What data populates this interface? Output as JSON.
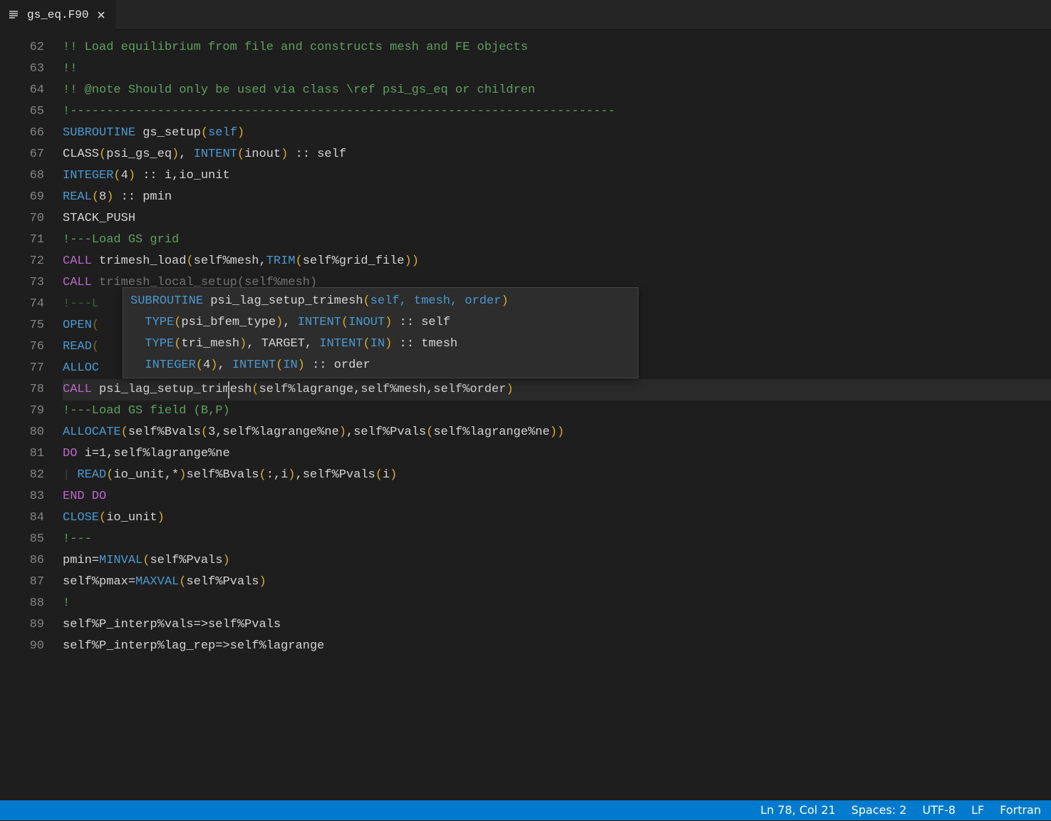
{
  "tab": {
    "filename": "gs_eq.F90"
  },
  "gutter": {
    "start": 62,
    "end": 90
  },
  "colors": {
    "background": "#1e1e1e",
    "statusbar": "#007acc",
    "keyword": "#4a9ad0",
    "control": "#ba68c8",
    "comment": "#5fa05f",
    "bracket": "#d4b02a"
  },
  "code": {
    "l62": "!! Load equilibrium from file and constructs mesh and FE objects",
    "l63": "!!",
    "l64": "!! @note Should only be used via class \\ref psi_gs_eq or children",
    "l65": "!---------------------------------------------------------------------------",
    "l66": {
      "kw": "SUBROUTINE",
      "name": " gs_setup",
      "open": "(",
      "arg": "self",
      "close": ")"
    },
    "l67": {
      "pre": "CLASS",
      "p1": "(",
      "a": "psi_gs_eq",
      "p2": ")",
      "comma": ", ",
      "kw": "INTENT",
      "p3": "(",
      "b": "inout",
      "p4": ")",
      "rest": " :: self"
    },
    "l68": {
      "kw": "INTEGER",
      "p1": "(",
      "n": "4",
      "p2": ")",
      "rest": " :: i,io_unit"
    },
    "l69": {
      "kw": "REAL",
      "p1": "(",
      "n": "8",
      "p2": ")",
      "rest": " :: pmin"
    },
    "l70": "STACK_PUSH",
    "l71": "!---Load GS grid",
    "l72": {
      "call": "CALL",
      "sp": " trimesh_load",
      "p1": "(",
      "a": "self%mesh,",
      "fn": "TRIM",
      "p2": "(",
      "b": "self%grid_file",
      "p3": "))"
    },
    "l73": {
      "call": "CALL",
      "rest": " trimesh_local_setup(self%mesh)"
    },
    "l74": "!---L",
    "l75": {
      "kw": "OPEN",
      "p": "("
    },
    "l76": {
      "kw": "READ",
      "p": "("
    },
    "l77": {
      "kw": "ALLOC"
    },
    "l78": {
      "call": "CALL",
      "sp": " ",
      "sel": "psi_lag_setup_t",
      "rest2": "rimesh",
      "p1": "(",
      "args": "self%lagrange,self%mesh,self%order",
      "p2": ")"
    },
    "l79": "!---Load GS field (B,P)",
    "l80": {
      "kw": "ALLOCATE",
      "p1": "(",
      "a": "self%Bvals",
      "p2": "(",
      "b": "3,self%lagrange%ne",
      "p3": ")",
      "c": ",self%Pvals",
      "p4": "(",
      "d": "self%lagrange%ne",
      "p5": "))"
    },
    "l81": {
      "kw": "DO",
      "rest": " i=1,self%lagrange%ne"
    },
    "l82": {
      "guide": "| ",
      "kw": "READ",
      "p1": "(",
      "a": "io_unit,*",
      "p2": ")",
      "b": "self%Bvals",
      "p3": "(",
      "c": ":,i",
      "p4": ")",
      "d": ",self%Pvals",
      "p5": "(",
      "e": "i",
      "p6": ")"
    },
    "l83": "END DO",
    "l84": {
      "kw": "CLOSE",
      "p1": "(",
      "a": "io_unit",
      "p2": ")"
    },
    "l85": "!---",
    "l86": {
      "a": "pmin=",
      "fn": "MINVAL",
      "p1": "(",
      "b": "self%Pvals",
      "p2": ")"
    },
    "l87": {
      "a": "self%pmax=",
      "fn": "MAXVAL",
      "p1": "(",
      "b": "self%Pvals",
      "p2": ")"
    },
    "l88": "!",
    "l89": "self%P_interp%vals=>self%Pvals",
    "l90": "self%P_interp%lag_rep=>self%lagrange"
  },
  "tooltip": {
    "t1": {
      "kw": "SUBROUTINE",
      "name": " psi_lag_setup_trimesh",
      "p1": "(",
      "args": "self, tmesh, order",
      "p2": ")"
    },
    "t2": {
      "ind": "  ",
      "kw": "TYPE",
      "p1": "(",
      "a": "psi_bfem_type",
      "p2": ")",
      "comma": ", ",
      "kw2": "INTENT",
      "p3": "(",
      "b": "INOUT",
      "p4": ")",
      "rest": " :: self"
    },
    "t3": {
      "ind": "  ",
      "kw": "TYPE",
      "p1": "(",
      "a": "tri_mesh",
      "p2": ")",
      "comma": ", TARGET, ",
      "kw2": "INTENT",
      "p3": "(",
      "b": "IN",
      "p4": ")",
      "rest": " :: tmesh"
    },
    "t4": {
      "ind": "  ",
      "kw": "INTEGER",
      "p1": "(",
      "a": "4",
      "p2": ")",
      "comma": ", ",
      "kw2": "INTENT",
      "p3": "(",
      "b": "IN",
      "p4": ")",
      "rest": " :: order"
    }
  },
  "status": {
    "lncol": "Ln 78, Col 21",
    "spaces": "Spaces: 2",
    "encoding": "UTF-8",
    "eol": "LF",
    "language": "Fortran"
  }
}
